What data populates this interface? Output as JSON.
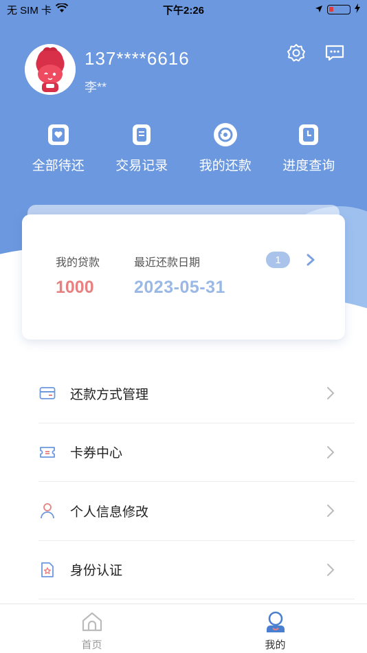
{
  "status_bar": {
    "carrier": "无 SIM 卡",
    "time": "下午2:26",
    "battery_color": "#e23b3b"
  },
  "profile": {
    "phone": "137****6616",
    "name": "李**",
    "avatar_icon": "mascot-avatar-icon",
    "settings_icon": "gear-icon",
    "message_icon": "message-bubble-icon"
  },
  "quick_actions": [
    {
      "label": "全部待还",
      "icon": "heart-card-icon"
    },
    {
      "label": "交易记录",
      "icon": "document-icon"
    },
    {
      "label": "我的还款",
      "icon": "refresh-icon"
    },
    {
      "label": "进度查询",
      "icon": "clock-doc-icon"
    }
  ],
  "loan_card": {
    "loan_label": "我的贷款",
    "loan_amount": "1000",
    "date_label": "最近还款日期",
    "date_value": "2023-05-31",
    "badge_count": "1",
    "amount_color": "#e98080",
    "date_color": "#9ab8e6"
  },
  "menu": [
    {
      "label": "还款方式管理",
      "icon": "credit-card-icon"
    },
    {
      "label": "卡券中心",
      "icon": "coupon-icon"
    },
    {
      "label": "个人信息修改",
      "icon": "person-icon"
    },
    {
      "label": "身份认证",
      "icon": "id-verify-icon"
    }
  ],
  "tabs": [
    {
      "label": "首页",
      "icon": "home-icon",
      "active": false
    },
    {
      "label": "我的",
      "icon": "profile-icon",
      "active": true
    }
  ],
  "colors": {
    "header_blue": "#6b98de",
    "accent_blue": "#4a7fd0"
  }
}
